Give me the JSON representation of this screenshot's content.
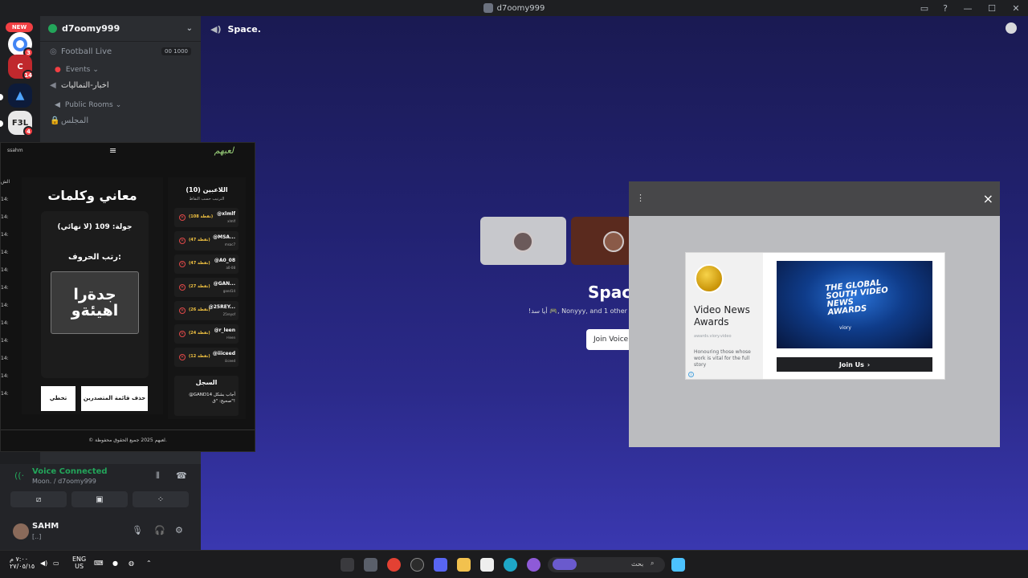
{
  "window": {
    "title": "d7oomy999"
  },
  "servers": {
    "new_label": "NEW",
    "badges": [
      "3",
      "14",
      "4"
    ],
    "f3_label": "F3L"
  },
  "channels": {
    "server_name": "d7oomy999",
    "items": [
      {
        "label": "Football Live",
        "pill_a": "00",
        "pill_b": "1000"
      },
      {
        "label": "Events",
        "type": "category"
      },
      {
        "label": "اخبار-النماليات",
        "type": "text"
      },
      {
        "label": "Public Rooms",
        "type": "category"
      },
      {
        "label": "المجلس",
        "type": "voice"
      }
    ]
  },
  "main": {
    "channel_name": "Space.",
    "stage_title": "Space",
    "stage_sub": "!أيا سد 🎮, Nonyyy, and 1 other",
    "join_label": "Join Voice"
  },
  "ad": {
    "title": "Video News Awards",
    "domain": "awards.viory.video",
    "description": "Honouring those whose work is vital for the full story",
    "image_text": "THE GLOBAL SOUTH VIDEO NEWS AWARDS",
    "image_brand": "viory",
    "cta": "Join Us",
    "close": "×",
    "menu": "⋮",
    "info": "i"
  },
  "game": {
    "username": "ssahm",
    "logo": "لعبهم",
    "title": "معاني وكلمات",
    "round": "جولة: 109 (لا نهائي)",
    "instruction": "رتب الحروف:",
    "scrambled": "جدةرا اهيئةو",
    "btn_remove": "حذف قائمة المتصدرين",
    "btn_skip": "تخطي",
    "players_title": "اللاعبين (10)",
    "players_sub": "الترتيب حسب النقاط",
    "players": [
      {
        "name": "@xlmlf",
        "sub": "xlmlf",
        "score": "(108 نقطة)"
      },
      {
        "name": "@MSA...",
        "sub": "msac7",
        "score": "(47 نقطة)"
      },
      {
        "name": "@A0_08",
        "sub": "a0-08",
        "score": "(47 نقطة)"
      },
      {
        "name": "@GAN...",
        "sub": "gand14",
        "score": "(27 نقطة)"
      },
      {
        "name": "@25REY...",
        "sub": "25reyof",
        "score": "(26 نقطة)"
      },
      {
        "name": "@r_leen",
        "sub": "r-leen",
        "score": "(24 نقطة)"
      },
      {
        "name": "@iiiceed",
        "sub": "iiiceed",
        "score": "(12 نقطة)"
      }
    ],
    "log_title": "السجل",
    "log_text": "@GAND14 أجاب بشكل صحيح: \"ق\"!",
    "left_col": [
      "الش",
      "14:",
      "14:",
      "14:",
      "14:",
      "14:",
      "14:",
      "14:",
      "14:",
      "14:",
      "14:",
      "14:",
      "14:"
    ],
    "footer": "© لعبهم 2025 جميع الحقوق محفوظة."
  },
  "voice": {
    "status": "Voice Connected",
    "location": "Moon. / d7oomy999"
  },
  "user": {
    "name": "SAHM",
    "status": "[..]"
  },
  "taskbar": {
    "search_placeholder": "بحث",
    "lang_top": "ENG",
    "lang_bottom": "US",
    "time": "٧:٠٠ م",
    "date": "٢٧/٠٥/١٥"
  },
  "colors": {
    "accent": "#23a55a",
    "danger": "#f23f43",
    "ad_button": "#202124"
  }
}
